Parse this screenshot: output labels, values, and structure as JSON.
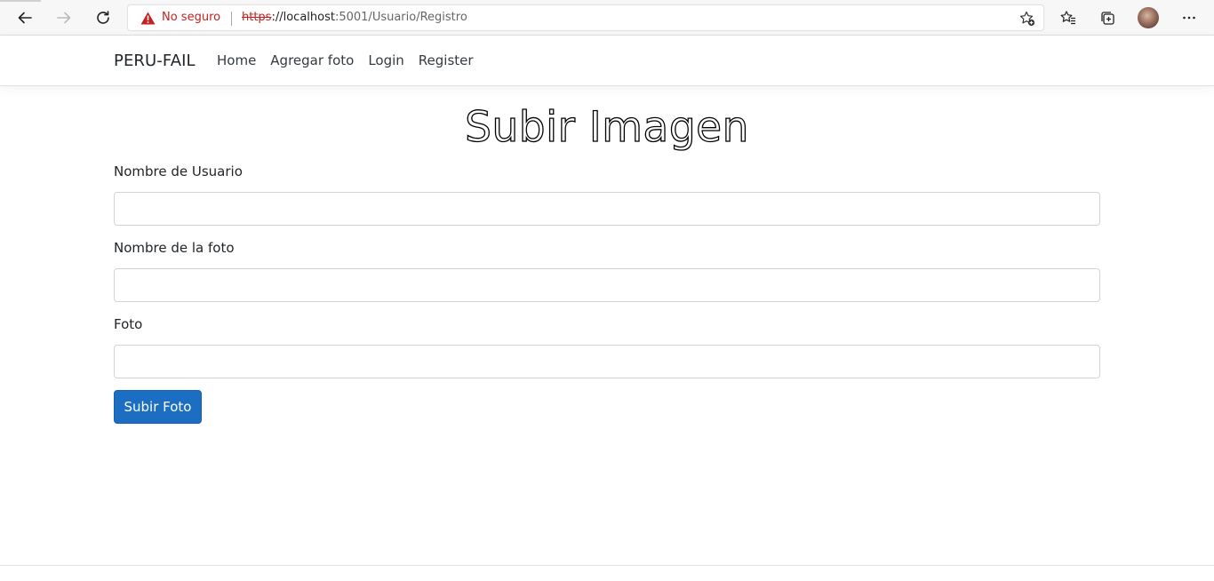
{
  "browser": {
    "security_label": "No seguro",
    "url_scheme": "https",
    "url_host": "://localhost",
    "url_rest": ":5001/Usuario/Registro",
    "icons": [
      "back-icon",
      "forward-icon",
      "refresh-icon",
      "warning-icon",
      "add-favorite-icon",
      "favorites-icon",
      "collections-icon",
      "profile-avatar",
      "more-icon"
    ]
  },
  "navbar": {
    "brand": "PERU-FAIL",
    "links": [
      "Home",
      "Agregar foto",
      "Login",
      "Register"
    ]
  },
  "form": {
    "title": "Subir Imagen",
    "fields": [
      {
        "label": "Nombre de Usuario",
        "value": "",
        "placeholder": ""
      },
      {
        "label": "Nombre de la foto",
        "value": "",
        "placeholder": ""
      },
      {
        "label": "Foto",
        "value": "",
        "placeholder": ""
      }
    ],
    "submit_label": "Subir Foto"
  },
  "colors": {
    "primary_button": "#1b6ec2",
    "not_secure_red": "#c5221f"
  }
}
